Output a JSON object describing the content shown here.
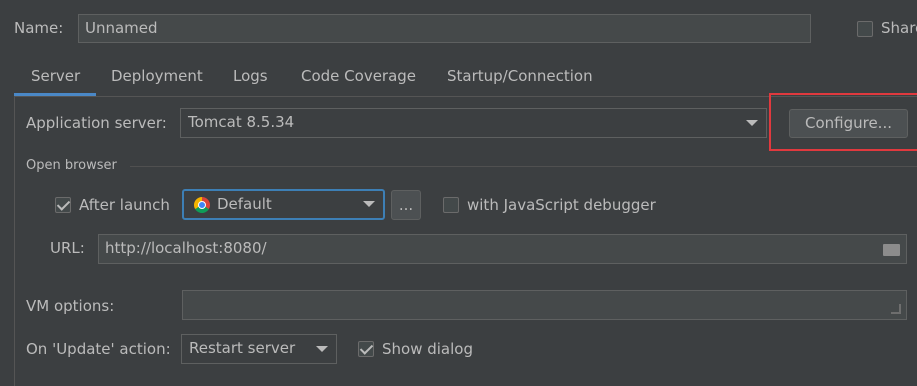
{
  "name_field": {
    "label": "Name:",
    "value": "Unnamed"
  },
  "share_checkbox": {
    "label": "Share"
  },
  "tabs": [
    {
      "label": "Server"
    },
    {
      "label": "Deployment"
    },
    {
      "label": "Logs"
    },
    {
      "label": "Code Coverage"
    },
    {
      "label": "Startup/Connection"
    }
  ],
  "app_server": {
    "label": "Application server:",
    "value": "Tomcat 8.5.34",
    "configure_label": "Configure..."
  },
  "open_browser": {
    "section_label": "Open browser",
    "after_launch_label": "After launch",
    "browser_value": "Default",
    "more_label": "...",
    "js_debugger_label": "with JavaScript debugger",
    "url_label": "URL:",
    "url_value": "http://localhost:8080/"
  },
  "vm_options": {
    "label": "VM options:",
    "value": ""
  },
  "update_action": {
    "label": "On 'Update' action:",
    "value": "Restart server",
    "show_dialog_label": "Show dialog"
  },
  "colors": {
    "highlight_box": "#e0393e",
    "focus_border": "#3d7fb5",
    "tab_underline": "#4a88c7"
  }
}
